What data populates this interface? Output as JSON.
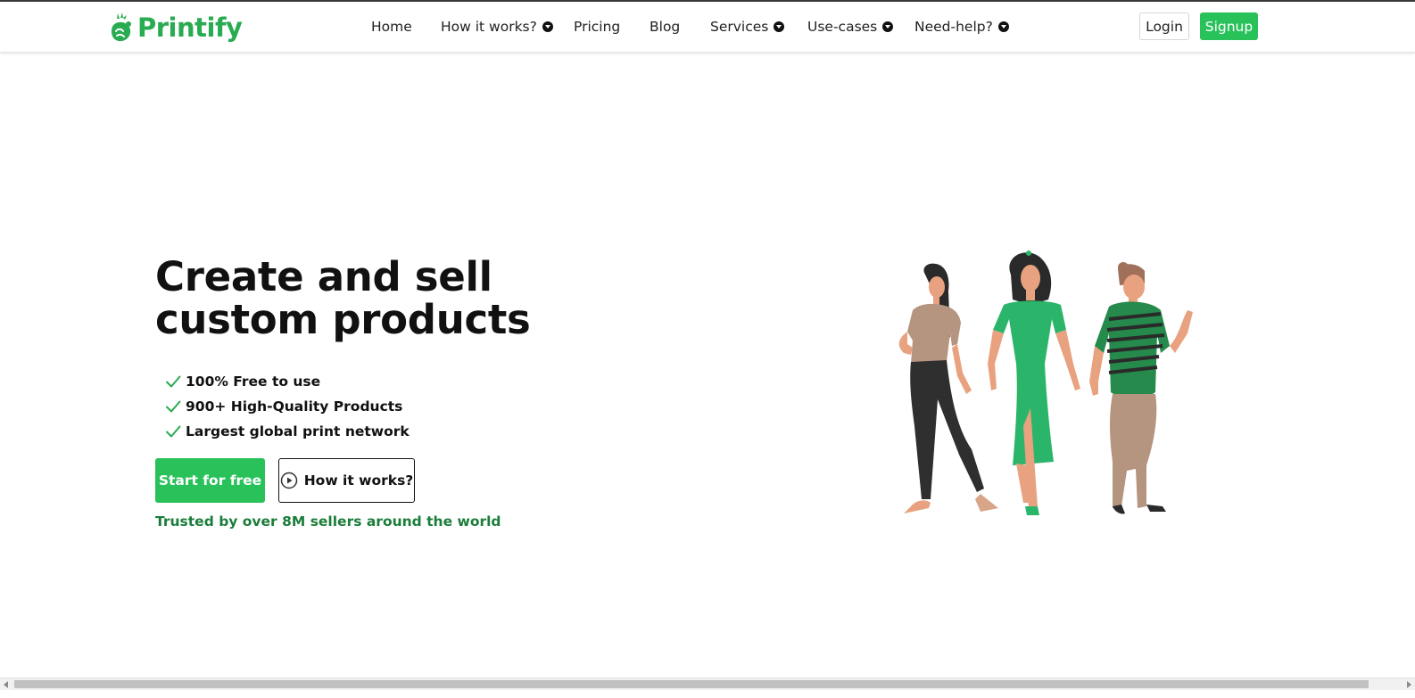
{
  "brand": {
    "name": "Printify",
    "color": "#29ab51"
  },
  "nav": {
    "items": [
      {
        "label": "Home",
        "dropdown": false
      },
      {
        "label": "How it works?",
        "dropdown": true
      },
      {
        "label": "Pricing",
        "dropdown": false
      },
      {
        "label": "Blog",
        "dropdown": false
      },
      {
        "label": "Services",
        "dropdown": true
      },
      {
        "label": "Use-cases",
        "dropdown": true
      },
      {
        "label": "Need-help?",
        "dropdown": true
      }
    ],
    "login_label": "Login",
    "signup_label": "Signup",
    "signup_color": "#29c15a"
  },
  "hero": {
    "title_line1": "Create and sell",
    "title_line2": "custom products",
    "features": [
      "100% Free to use",
      "900+ High-Quality Products",
      "Largest global print network"
    ],
    "primary_cta": "Start for free",
    "secondary_cta": "How it works?",
    "trusted_text": "Trusted by over 8M sellers around the world",
    "trusted_color": "#1b7d3a"
  },
  "icons": {
    "check": "check-icon",
    "play": "play-circle-icon",
    "caret": "chevron-down-circle-icon"
  }
}
